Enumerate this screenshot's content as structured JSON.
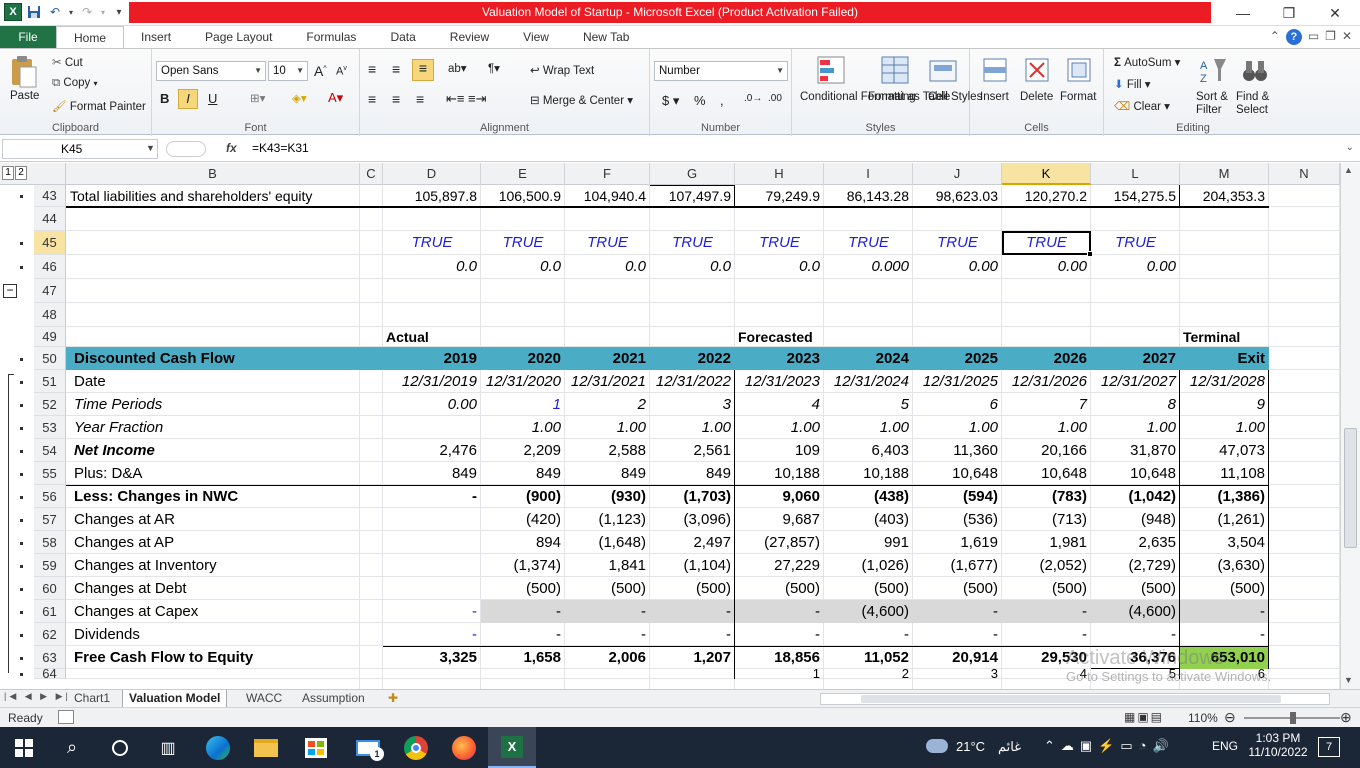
{
  "window": {
    "title": "Valuation Model of Startup  -  Microsoft Excel (Product Activation Failed)"
  },
  "ribbon_tabs": [
    "File",
    "Home",
    "Insert",
    "Page Layout",
    "Formulas",
    "Data",
    "Review",
    "View",
    "New Tab"
  ],
  "ribbon": {
    "clipboard": {
      "paste": "Paste",
      "cut": "Cut",
      "copy": "Copy",
      "format_painter": "Format Painter",
      "label": "Clipboard"
    },
    "font": {
      "name": "Open Sans",
      "size": "10",
      "bold": "B",
      "italic": "I",
      "underline": "U",
      "label": "Font"
    },
    "alignment": {
      "wrap": "Wrap Text",
      "merge": "Merge & Center",
      "label": "Alignment"
    },
    "number": {
      "format": "Number",
      "currency": "$",
      "percent": "%",
      "comma": ",",
      "label": "Number"
    },
    "styles": {
      "conditional": "Conditional Formatting",
      "table": "Format as Table",
      "cell": "Cell Styles",
      "label": "Styles"
    },
    "cells": {
      "insert": "Insert",
      "delete": "Delete",
      "format": "Format",
      "label": "Cells"
    },
    "editing": {
      "autosum": "AutoSum",
      "fill": "Fill",
      "clear": "Clear",
      "sort": "Sort & Filter",
      "find": "Find & Select",
      "label": "Editing"
    }
  },
  "formula_bar": {
    "name_box": "K45",
    "fx": "fx",
    "formula": "=K43=K31"
  },
  "columns": [
    "B",
    "C",
    "D",
    "E",
    "F",
    "G",
    "H",
    "I",
    "J",
    "K",
    "L",
    "M",
    "N"
  ],
  "selected_column": "K",
  "rows": [
    43,
    44,
    45,
    46,
    47,
    48,
    49,
    50,
    51,
    52,
    53,
    54,
    55,
    56,
    57,
    58,
    59,
    60,
    61,
    62,
    63,
    64
  ],
  "selected_row": 45,
  "row_labels": {
    "43": "Total liabilities and shareholders' equity",
    "50": "Discounted Cash Flow",
    "51": "Date",
    "52": "Time Periods",
    "53": "Year Fraction",
    "54": "Net Income",
    "55": "Plus: D&A",
    "56": "Less: Changes in NWC",
    "57": "Changes at AR",
    "58": "Changes at AP",
    "59": "Changes at Inventory",
    "60": "Changes at Debt",
    "61": "Changes at Capex",
    "62": "Dividends",
    "63": "Free Cash Flow to Equity"
  },
  "section_headers": {
    "actual": "Actual",
    "forecasted": "Forecasted",
    "terminal": "Terminal"
  },
  "grid": {
    "43": [
      "105,897.8",
      "106,500.9",
      "104,940.4",
      "107,497.9",
      "79,249.9",
      "86,143.28",
      "98,623.03",
      "120,270.2",
      "154,275.5",
      "204,353.3"
    ],
    "45": [
      "TRUE",
      "TRUE",
      "TRUE",
      "TRUE",
      "TRUE",
      "TRUE",
      "TRUE",
      "TRUE",
      "TRUE",
      ""
    ],
    "46": [
      "0.0",
      "0.0",
      "0.0",
      "0.0",
      "0.0",
      "0.000",
      "0.00",
      "0.00",
      "0.00",
      ""
    ],
    "50": [
      "2019",
      "2020",
      "2021",
      "2022",
      "2023",
      "2024",
      "2025",
      "2026",
      "2027",
      "Exit"
    ],
    "51": [
      "12/31/2019",
      "12/31/2020",
      "12/31/2021",
      "12/31/2022",
      "12/31/2023",
      "12/31/2024",
      "12/31/2025",
      "12/31/2026",
      "12/31/2027",
      "12/31/2028"
    ],
    "52": [
      "0.00",
      "1",
      "2",
      "3",
      "4",
      "5",
      "6",
      "7",
      "8",
      "9"
    ],
    "53": [
      "",
      "1.00",
      "1.00",
      "1.00",
      "1.00",
      "1.00",
      "1.00",
      "1.00",
      "1.00",
      "1.00"
    ],
    "54": [
      "2,476",
      "2,209",
      "2,588",
      "2,561",
      "109",
      "6,403",
      "11,360",
      "20,166",
      "31,870",
      "47,073"
    ],
    "55": [
      "849",
      "849",
      "849",
      "849",
      "10,188",
      "10,188",
      "10,648",
      "10,648",
      "10,648",
      "11,108"
    ],
    "56": [
      "-",
      "(900)",
      "(930)",
      "(1,703)",
      "9,060",
      "(438)",
      "(594)",
      "(783)",
      "(1,042)",
      "(1,386)"
    ],
    "57": [
      "",
      "(420)",
      "(1,123)",
      "(3,096)",
      "9,687",
      "(403)",
      "(536)",
      "(713)",
      "(948)",
      "(1,261)"
    ],
    "58": [
      "",
      "894",
      "(1,648)",
      "2,497",
      "(27,857)",
      "991",
      "1,619",
      "1,981",
      "2,635",
      "3,504"
    ],
    "59": [
      "",
      "(1,374)",
      "1,841",
      "(1,104)",
      "27,229",
      "(1,026)",
      "(1,677)",
      "(2,052)",
      "(2,729)",
      "(3,630)"
    ],
    "60": [
      "",
      "(500)",
      "(500)",
      "(500)",
      "(500)",
      "(500)",
      "(500)",
      "(500)",
      "(500)",
      "(500)"
    ],
    "61": [
      "-",
      "-",
      "-",
      "-",
      "-",
      "(4,600)",
      "-",
      "-",
      "(4,600)",
      "-"
    ],
    "62": [
      "-",
      "-",
      "-",
      "-",
      "-",
      "-",
      "-",
      "-",
      "-",
      "-"
    ],
    "63": [
      "3,325",
      "1,658",
      "2,006",
      "1,207",
      "18,856",
      "11,052",
      "20,914",
      "29,530",
      "36,376",
      "653,010"
    ],
    "64": [
      "",
      "",
      "",
      "",
      "1",
      "2",
      "3",
      "4",
      "5",
      "6"
    ]
  },
  "sheet_tabs": [
    "Chart1",
    "Valuation Model",
    "WACC",
    "Assumption"
  ],
  "active_sheet": "Valuation Model",
  "status": {
    "ready": "Ready",
    "zoom": "110%"
  },
  "watermark": {
    "line1": "Activate Windows",
    "line2": "Go to Settings to activate Windows."
  },
  "taskbar": {
    "weather": "21°C",
    "weather_text": "غائم",
    "lang": "ENG",
    "time": "1:03 PM",
    "date": "11/10/2022",
    "notifications": "7",
    "mail_badge": "1"
  },
  "colors": {
    "excel_green": "#217346",
    "title_red": "#ec1c24",
    "dcf_header": "#4bacc6",
    "terminal_green": "#92d050",
    "check_blue": "#1f1fd1",
    "capex_gray": "#d9d9d9",
    "taskbar": "#1b2636"
  }
}
